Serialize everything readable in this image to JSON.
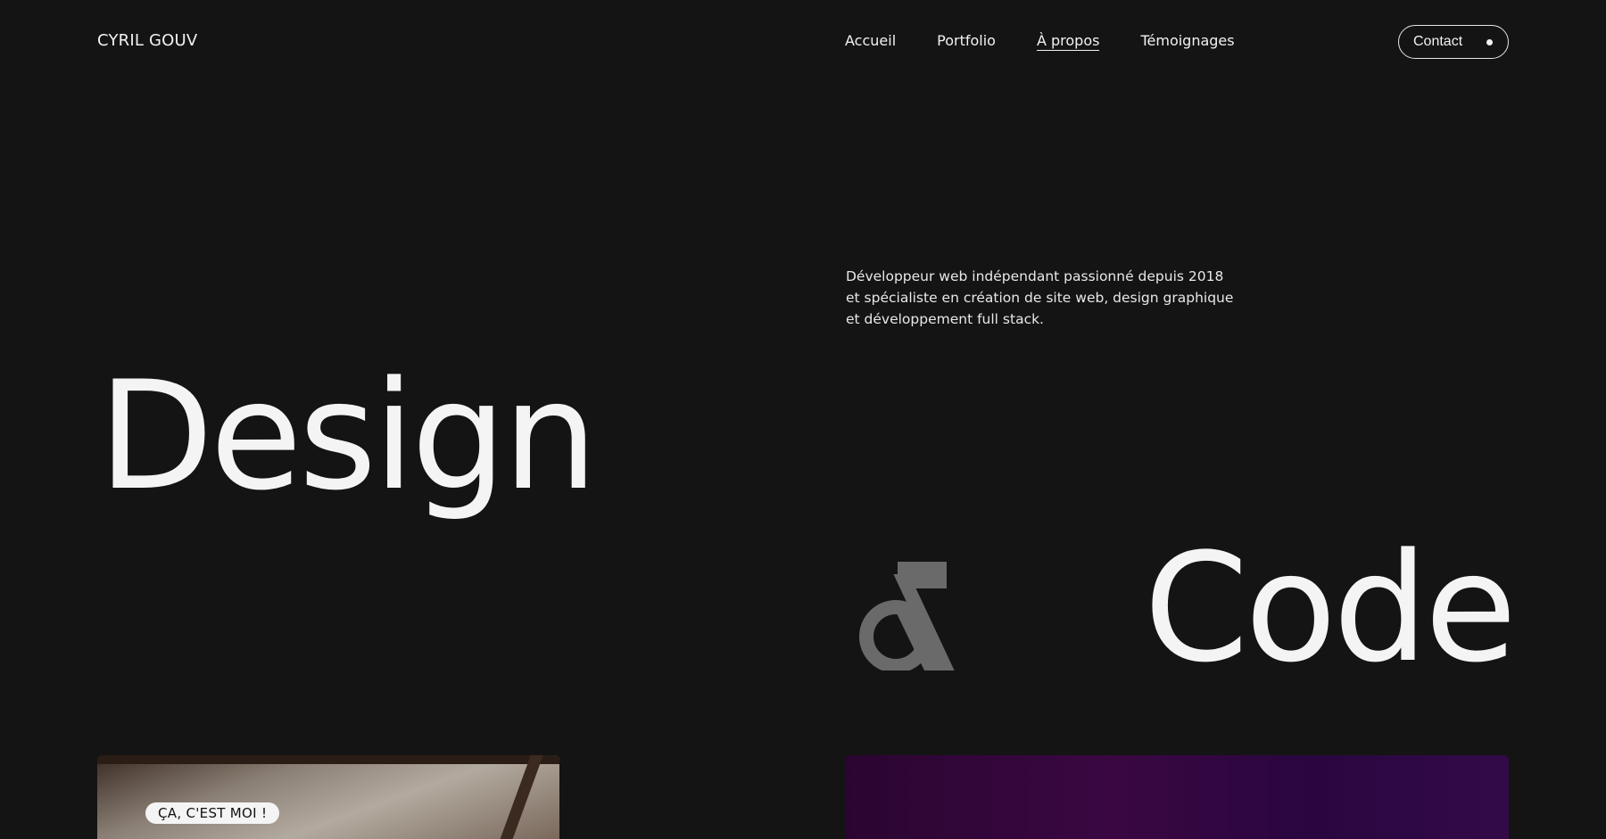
{
  "header": {
    "logo": "CYRIL GOUV",
    "nav": [
      {
        "label": "Accueil",
        "active": false
      },
      {
        "label": "Portfolio",
        "active": false
      },
      {
        "label": "À propos",
        "active": true
      },
      {
        "label": "Témoignages",
        "active": false
      }
    ],
    "contact_label": "Contact"
  },
  "hero": {
    "intro": "Développeur web indépendant passionné depuis 2018 et spécialiste en création de site web, design graphique et développement full stack.",
    "word_left": "Design",
    "word_right": "Code"
  },
  "gallery": {
    "photo_badge": "ÇA, C'EST MOI !"
  },
  "colors": {
    "background": "#141414",
    "text": "#f2f2f2",
    "ampersand": "#6a6a6a",
    "code_card": "#3a0742"
  },
  "icons": {
    "ampersand": "ampersand-icon",
    "contact_dot": "dot-icon"
  }
}
